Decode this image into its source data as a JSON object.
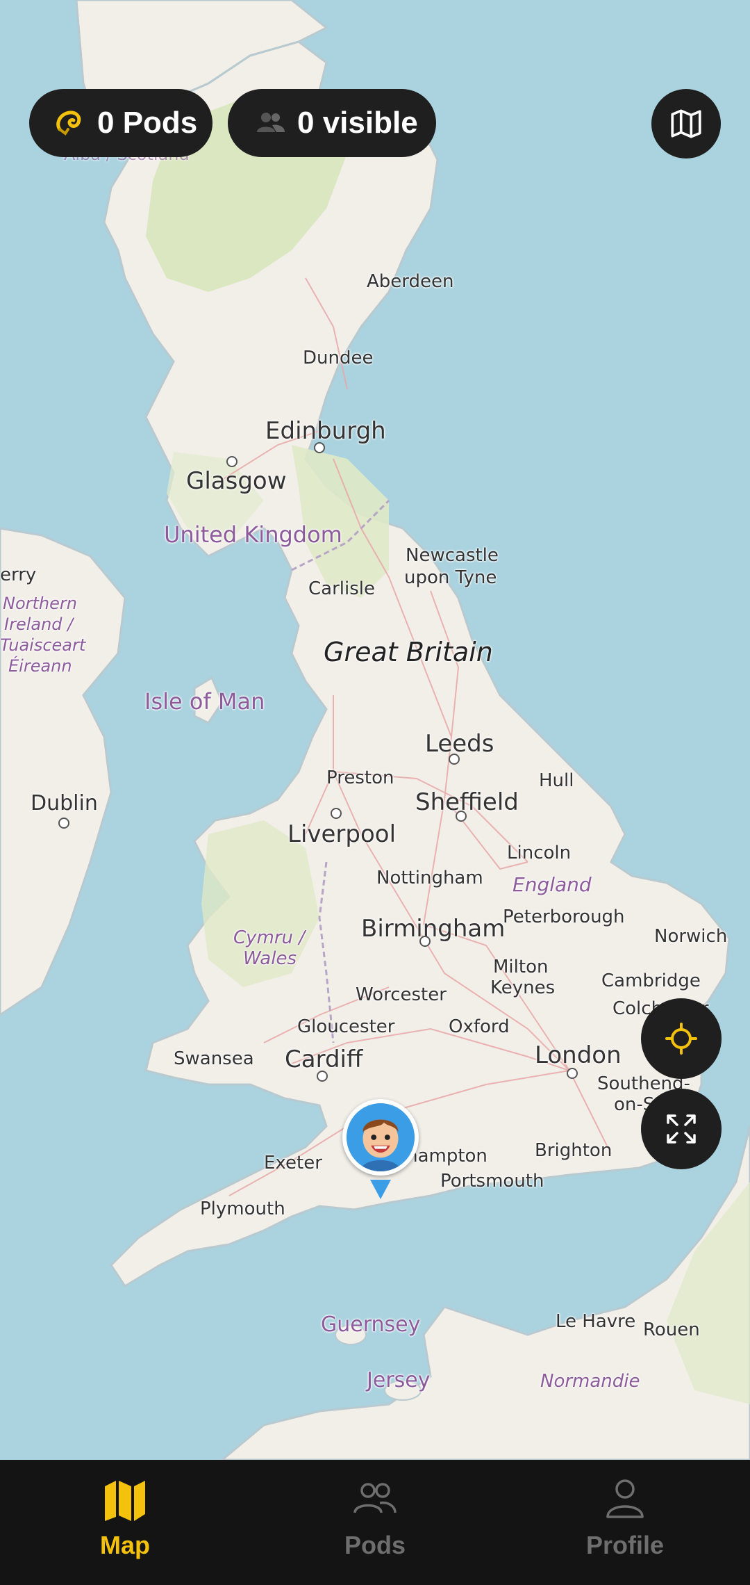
{
  "status_chips": {
    "pods_label": "0 Pods",
    "pods_icon": "pod-icon",
    "visible_label": "0 visible",
    "visible_icon": "people-icon"
  },
  "map": {
    "places": [
      {
        "key": "aberdeen",
        "name": "Aberdeen"
      },
      {
        "key": "dundee",
        "name": "Dundee"
      },
      {
        "key": "edinburgh",
        "name": "Edinburgh"
      },
      {
        "key": "glasgow",
        "name": "Glasgow"
      },
      {
        "key": "uk",
        "name": "United Kingdom"
      },
      {
        "key": "newcastle1",
        "name": "Newcastle"
      },
      {
        "key": "newcastle2",
        "name": "upon Tyne"
      },
      {
        "key": "carlisle",
        "name": "Carlisle"
      },
      {
        "key": "gb",
        "name": "Great Britain"
      },
      {
        "key": "isle_of_man",
        "name": "Isle of Man"
      },
      {
        "key": "leeds",
        "name": "Leeds"
      },
      {
        "key": "preston",
        "name": "Preston"
      },
      {
        "key": "hull",
        "name": "Hull"
      },
      {
        "key": "sheffield",
        "name": "Sheffield"
      },
      {
        "key": "liverpool",
        "name": "Liverpool"
      },
      {
        "key": "lincoln",
        "name": "Lincoln"
      },
      {
        "key": "nottingham",
        "name": "Nottingham"
      },
      {
        "key": "england",
        "name": "England"
      },
      {
        "key": "birmingham",
        "name": "Birmingham"
      },
      {
        "key": "peterborough",
        "name": "Peterborough"
      },
      {
        "key": "norwich",
        "name": "Norwich"
      },
      {
        "key": "cymru1",
        "name": "Cymru /"
      },
      {
        "key": "cymru2",
        "name": "Wales"
      },
      {
        "key": "milton1",
        "name": "Milton"
      },
      {
        "key": "milton2",
        "name": "Keynes"
      },
      {
        "key": "worcester",
        "name": "Worcester"
      },
      {
        "key": "cambridge",
        "name": "Cambridge"
      },
      {
        "key": "colchester",
        "name": "Colchester"
      },
      {
        "key": "gloucester",
        "name": "Gloucester"
      },
      {
        "key": "oxford",
        "name": "Oxford"
      },
      {
        "key": "swansea",
        "name": "Swansea"
      },
      {
        "key": "cardiff",
        "name": "Cardiff"
      },
      {
        "key": "london",
        "name": "London"
      },
      {
        "key": "southend1",
        "name": "Southend-"
      },
      {
        "key": "southend2",
        "name": "on-Sea"
      },
      {
        "key": "exeter",
        "name": "Exeter"
      },
      {
        "key": "southampton",
        "name": "Southampton"
      },
      {
        "key": "brighton",
        "name": "Brighton"
      },
      {
        "key": "portsmouth",
        "name": "Portsmouth"
      },
      {
        "key": "plymouth",
        "name": "Plymouth"
      },
      {
        "key": "guernsey",
        "name": "Guernsey"
      },
      {
        "key": "jersey",
        "name": "Jersey"
      },
      {
        "key": "le_havre",
        "name": "Le Havre"
      },
      {
        "key": "rouen",
        "name": "Rouen"
      },
      {
        "key": "normandie",
        "name": "Normandie"
      },
      {
        "key": "dublin",
        "name": "Dublin"
      },
      {
        "key": "derry",
        "name": "erry"
      },
      {
        "key": "ni1",
        "name": "Northern"
      },
      {
        "key": "ni2",
        "name": "Ireland /"
      },
      {
        "key": "ni3",
        "name": "Tuaisceart"
      },
      {
        "key": "ni4",
        "name": "Éireann"
      },
      {
        "key": "alba",
        "name": "Alba / Scotland"
      }
    ]
  },
  "controls": {
    "layers_icon": "map-layers-icon",
    "locate_icon": "crosshair-icon",
    "fullscreen_icon": "expand-icon"
  },
  "bottom_nav": {
    "items": [
      {
        "label": "Map",
        "icon": "map-icon",
        "active": true
      },
      {
        "label": "Pods",
        "icon": "group-icon",
        "active": false
      },
      {
        "label": "Profile",
        "icon": "person-icon",
        "active": false
      }
    ]
  },
  "colors": {
    "accent": "#f4c20d",
    "water": "#aad3df",
    "land": "#f2efe9",
    "chip_bg": "#1f1f1f",
    "nav_bg": "#141414",
    "inactive": "#6e6e6e",
    "marker": "#3b9de6"
  }
}
